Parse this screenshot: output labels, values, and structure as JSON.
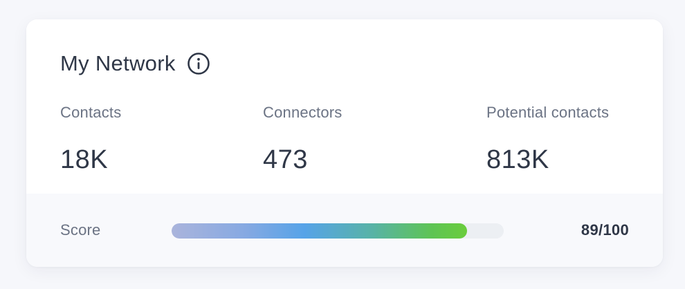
{
  "card": {
    "title": "My Network",
    "info_icon": "info-circle-icon"
  },
  "stats": {
    "contacts": {
      "label": "Contacts",
      "value": "18K"
    },
    "connectors": {
      "label": "Connectors",
      "value": "473"
    },
    "potential": {
      "label": "Potential contacts",
      "value": "813K"
    }
  },
  "score": {
    "label": "Score",
    "value": 89,
    "max": 100,
    "display": "89/100",
    "gradient_colors": [
      "#aab4dc",
      "#56a3e8",
      "#6acd3c"
    ]
  }
}
